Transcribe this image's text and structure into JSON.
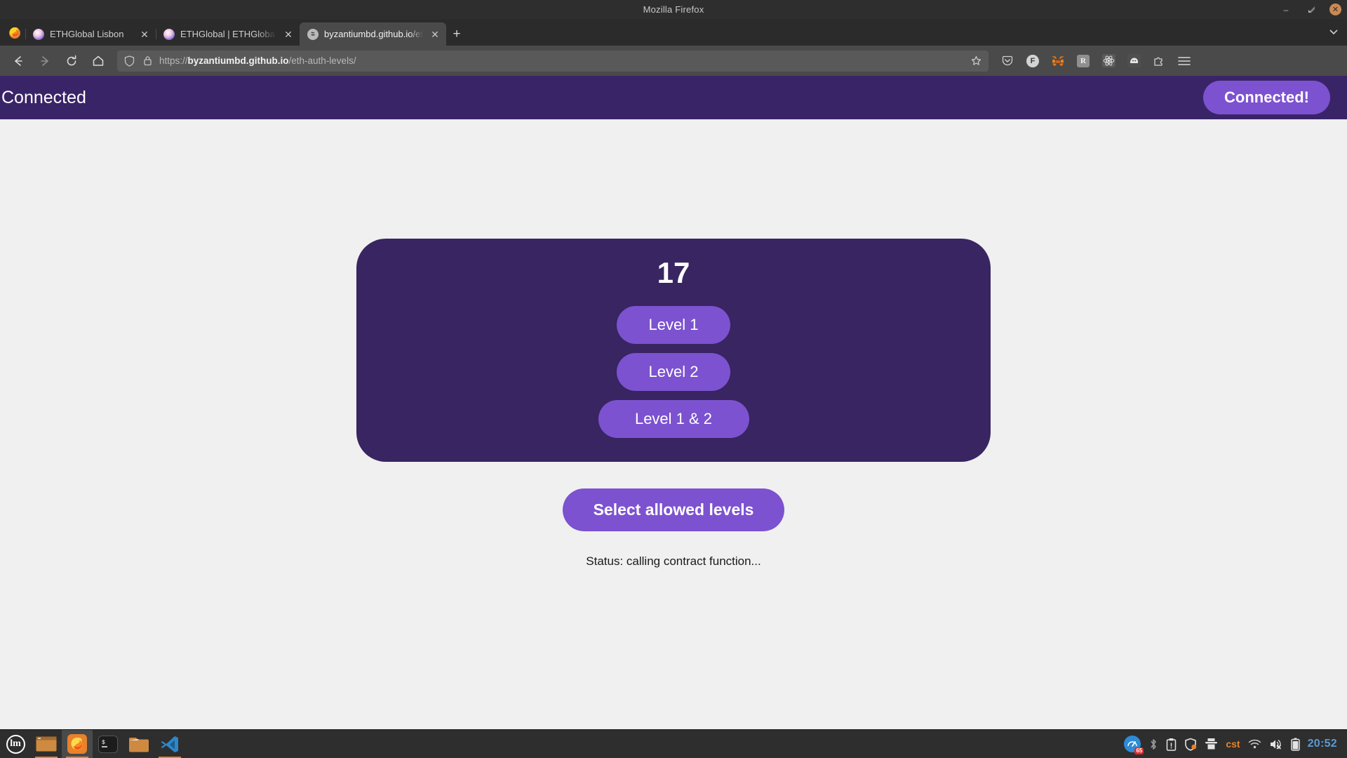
{
  "window": {
    "title": "Mozilla Firefox",
    "controls": {
      "minimize": "–",
      "restore": "❐",
      "close": "✕"
    }
  },
  "browser": {
    "tabs": [
      {
        "title": "ETHGlobal Lisbon",
        "favicon": "ethglobal-icon",
        "active": false,
        "close_label": "✕"
      },
      {
        "title": "ETHGlobal | ETHGlobal Lisb",
        "favicon": "ethglobal-icon",
        "active": false,
        "close_label": "✕"
      },
      {
        "title": "byzantiumbd.github.io/eth-a",
        "favicon": "github-pages-icon",
        "active": true,
        "close_label": "✕"
      }
    ],
    "new_tab_label": "+",
    "list_all_tabs_label": "⌄",
    "nav": {
      "back": "←",
      "forward": "→",
      "reload": "↻",
      "home": "⌂"
    },
    "urlbar": {
      "scheme": "https://",
      "host": "byzantiumbd.github.io",
      "path": "/eth-auth-levels/",
      "full_url": "https://byzantiumbd.github.io/eth-auth-levels/",
      "shield_icon": "shield-icon",
      "lock_icon": "lock-icon",
      "bookmark_icon": "star-icon"
    },
    "toolbar_extensions": [
      {
        "name": "pocket-icon",
        "label": ""
      },
      {
        "name": "frame-extension-icon",
        "label": "F"
      },
      {
        "name": "metamask-icon",
        "label": ""
      },
      {
        "name": "rabby-wallet-icon",
        "label": "R"
      },
      {
        "name": "react-devtools-icon",
        "label": ""
      },
      {
        "name": "phantom-wallet-icon",
        "label": ""
      },
      {
        "name": "extensions-puzzle-icon",
        "label": ""
      }
    ],
    "menu_icon": "hamburger-menu-icon"
  },
  "app": {
    "header": {
      "status_text": "Connected",
      "connect_button_label": "Connected!"
    },
    "card": {
      "count": "17",
      "level_buttons": [
        {
          "label": "Level 1"
        },
        {
          "label": "Level 2"
        },
        {
          "label": "Level 1 & 2"
        }
      ]
    },
    "select_button_label": "Select allowed levels",
    "status_line": "Status: calling contract function...",
    "colors": {
      "header_bg": "#3a2468",
      "card_bg": "#382561",
      "accent_purple": "#7c52d0",
      "page_bg": "#f0f0f0"
    }
  },
  "taskbar": {
    "apps": [
      {
        "name": "mint-menu-button",
        "label": "lm"
      },
      {
        "name": "window-list-item",
        "label": ""
      },
      {
        "name": "firefox-taskbar-item",
        "label": ""
      },
      {
        "name": "terminal-taskbar-item",
        "label": ""
      },
      {
        "name": "files-taskbar-item",
        "label": ""
      },
      {
        "name": "vscode-taskbar-item",
        "label": ""
      }
    ],
    "tray": {
      "speedtest_badge": "65",
      "keyboard_layout": "cst",
      "clock": "20:52",
      "icons": [
        "bluetooth-icon",
        "clipboard-icon",
        "shield-icon",
        "printer-icon",
        "wifi-icon",
        "volume-muted-icon",
        "battery-icon"
      ]
    }
  }
}
